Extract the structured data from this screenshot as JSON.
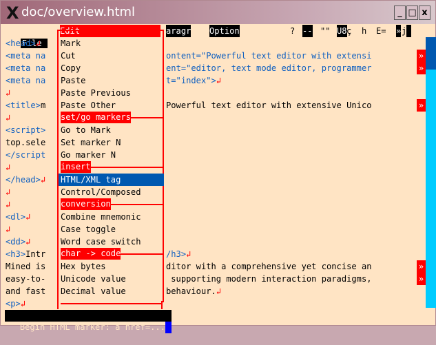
{
  "window": {
    "title": "doc/overview.html",
    "minimize": "_",
    "maximize": "□",
    "close": "x"
  },
  "menubar": {
    "file": "File",
    "edit": "Edit",
    "paragraph": "aragr",
    "options": "Option",
    "help": "?",
    "flag1": "--",
    "quotes": "\"\"",
    "encoding": "U8",
    "cedilla": "ç",
    "h": "h",
    "e": "E=",
    "mark": "»",
    "j": "j"
  },
  "lines": [
    {
      "left": [
        [
          "<head>",
          "b"
        ],
        [
          "↲",
          "r"
        ]
      ],
      "right": []
    },
    {
      "left": [
        [
          "<meta na",
          "b"
        ]
      ],
      "right": [
        [
          "ontent=\"Powerful text editor with extensi",
          "b"
        ]
      ],
      "more": "»"
    },
    {
      "left": [
        [
          "<meta na",
          "b"
        ]
      ],
      "right": [
        [
          "ent=\"editor, text mode editor, programmer",
          "b"
        ]
      ],
      "more": "»"
    },
    {
      "left": [
        [
          "<meta na",
          "b"
        ]
      ],
      "right": [
        [
          "t=\"index\">",
          "b"
        ],
        [
          "↲",
          "r"
        ]
      ]
    },
    {
      "left": [
        [
          "↲",
          "r"
        ]
      ],
      "right": []
    },
    {
      "left": [
        [
          "<title>",
          "b"
        ],
        [
          "m",
          "k"
        ]
      ],
      "right": [
        [
          "Powerful text editor with extensive Unico",
          "k"
        ]
      ],
      "more": "»"
    },
    {
      "left": [
        [
          "↲",
          "r"
        ]
      ],
      "right": []
    },
    {
      "left": [
        [
          "<script>",
          "b"
        ]
      ],
      "right": []
    },
    {
      "left": [
        [
          "top.sele",
          "k"
        ]
      ],
      "right": []
    },
    {
      "left": [
        [
          "</script",
          "b"
        ]
      ],
      "right": []
    },
    {
      "left": [
        [
          "↲",
          "r"
        ]
      ],
      "right": []
    },
    {
      "left": [
        [
          "</head>",
          "b"
        ],
        [
          "↲",
          "r"
        ]
      ],
      "right": []
    },
    {
      "left": [
        [
          "↲",
          "r"
        ]
      ],
      "right": []
    },
    {
      "left": [
        [
          "↲",
          "r"
        ]
      ],
      "right": []
    },
    {
      "left": [
        [
          "<dl>",
          "b"
        ],
        [
          "↲",
          "r"
        ]
      ],
      "right": []
    },
    {
      "left": [
        [
          "↲",
          "r"
        ]
      ],
      "right": []
    },
    {
      "left": [
        [
          "<dd>",
          "b"
        ],
        [
          "↲",
          "r"
        ]
      ],
      "right": []
    },
    {
      "left": [
        [
          "<h3>",
          "b"
        ],
        [
          "Intr",
          "k"
        ]
      ],
      "right": [
        [
          "/h3>",
          "b"
        ],
        [
          "↲",
          "r"
        ]
      ]
    },
    {
      "left": [
        [
          "Mined is",
          "k"
        ]
      ],
      "right": [
        [
          "ditor with a comprehensive yet concise an",
          "k"
        ]
      ],
      "more": "»"
    },
    {
      "left": [
        [
          "easy-to-",
          "k"
        ]
      ],
      "right": [
        [
          " supporting modern interaction paradigms,",
          "k"
        ]
      ],
      "more": "»"
    },
    {
      "left": [
        [
          "and fast",
          "k"
        ]
      ],
      "right": [
        [
          "behaviour.",
          "k"
        ],
        [
          "↲",
          "r"
        ]
      ]
    },
    {
      "left": [
        [
          "<p>",
          "b"
        ],
        [
          "↲",
          "r"
        ]
      ],
      "right": []
    }
  ],
  "edit_menu": [
    {
      "label": "Mark",
      "type": "item"
    },
    {
      "label": "Cut",
      "type": "item"
    },
    {
      "label": "Copy",
      "type": "item"
    },
    {
      "label": "Paste",
      "type": "item"
    },
    {
      "label": "Paste Previous",
      "type": "item"
    },
    {
      "label": "Paste Other",
      "type": "item"
    },
    {
      "label": "set/go markers",
      "type": "section"
    },
    {
      "label": "Go to Mark",
      "type": "item"
    },
    {
      "label": "Set marker N",
      "type": "item"
    },
    {
      "label": "Go marker N",
      "type": "item"
    },
    {
      "label": "insert",
      "type": "section"
    },
    {
      "label": "HTML/XML tag",
      "type": "selected"
    },
    {
      "label": "Control/Composed",
      "type": "item"
    },
    {
      "label": "conversion",
      "type": "section"
    },
    {
      "label": "Combine mnemonic",
      "type": "item"
    },
    {
      "label": "Case toggle",
      "type": "item"
    },
    {
      "label": "Word case switch",
      "type": "item"
    },
    {
      "label": "char -> code",
      "type": "section"
    },
    {
      "label": "Hex bytes",
      "type": "item"
    },
    {
      "label": "Unicode value",
      "type": "item"
    },
    {
      "label": "Decimal value",
      "type": "item"
    }
  ],
  "status": {
    "text": " Begin HTML marker: a href=..."
  },
  "colors": {
    "bg": "#ffe4c4",
    "accent": "#ff0000",
    "selected": "#0058b0",
    "tag": "#1060c0",
    "scroll": "#00ccff"
  }
}
